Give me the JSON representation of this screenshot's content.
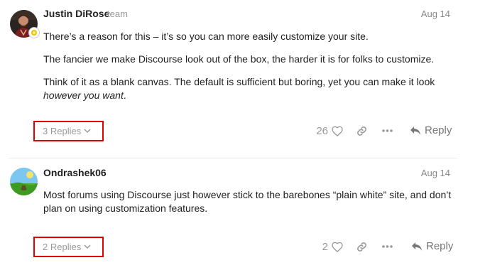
{
  "posts": [
    {
      "username": "Justin DiRose",
      "user_title": "team",
      "date": "Aug 14",
      "paragraphs": [
        "There’s a reason for this – it’s so you can more easily customize your site.",
        "The fancier we make Discourse look out of the box, the harder it is for folks to customize."
      ],
      "para3_prefix": "Think of it as a blank canvas. The default is sufficient but boring, yet you can make it look ",
      "para3_em": "however you want",
      "para3_suffix": ".",
      "replies_label": "3 Replies",
      "like_count": "26",
      "reply_label": "Reply"
    },
    {
      "username": "Ondrashek06",
      "date": "Aug 14",
      "paragraphs": [
        "Most forums using Discourse just however stick to the barebones “plain white” site, and don’t plan on using customization features."
      ],
      "replies_label": "2 Replies",
      "like_count": "2",
      "reply_label": "Reply"
    }
  ],
  "colors": {
    "highlight_border": "#e00000",
    "muted_text": "#999999",
    "divider": "#e9e9e9"
  },
  "icons": [
    "chevron-down-icon",
    "heart-icon",
    "link-icon",
    "ellipsis-icon",
    "reply-icon"
  ]
}
